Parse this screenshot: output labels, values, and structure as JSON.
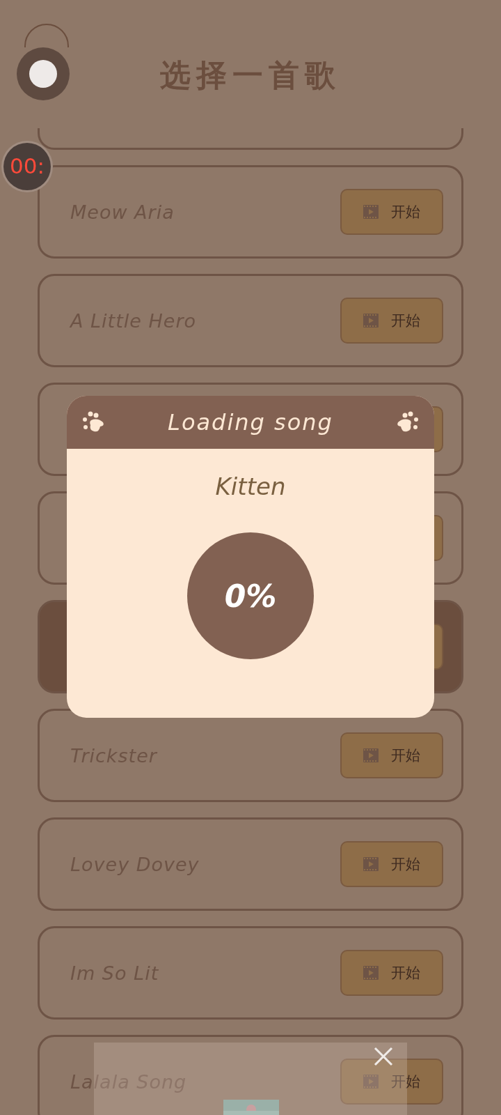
{
  "title": "选择一首歌",
  "timer": "00:",
  "songs": [
    {
      "name": "Meow Aria",
      "button": "开始",
      "selected": false
    },
    {
      "name": "A Little Hero",
      "button": "开始",
      "selected": false
    },
    {
      "selected": false
    },
    {
      "selected": false
    },
    {
      "selected": true
    },
    {
      "name": "Trickster",
      "button": "开始",
      "selected": false
    },
    {
      "name": "Lovey Dovey",
      "button": "开始",
      "selected": false
    },
    {
      "name": "Im So Lit",
      "button": "开始",
      "selected": false
    },
    {
      "name": "Lalala Song",
      "button": "开始",
      "selected": false
    }
  ],
  "dialog": {
    "title": "Loading song",
    "song": "Kitten",
    "progress": "0%"
  }
}
